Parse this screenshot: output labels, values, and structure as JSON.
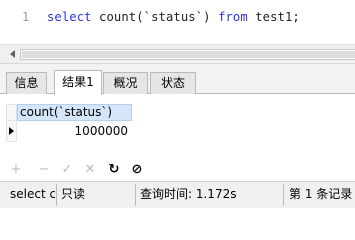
{
  "editor": {
    "line_number": "1",
    "code": {
      "kw_select": "select",
      "mid": " count(`status`) ",
      "kw_from": "from",
      "tail": " test1;"
    }
  },
  "tabs": [
    {
      "label": "信息"
    },
    {
      "label": "结果1",
      "active": true
    },
    {
      "label": "概况"
    },
    {
      "label": "状态"
    }
  ],
  "result": {
    "column": "count(`status`)",
    "rows": [
      [
        "1000000"
      ]
    ]
  },
  "grid_toolbar": {
    "add": "+",
    "delete": "−",
    "apply": "✓",
    "discard": "✕",
    "refresh": "↻",
    "stop": "⊘"
  },
  "status": {
    "sql": "select c",
    "mode": "只读",
    "query_time": "查询时间: 1.172s",
    "record": "第 1 条记录"
  },
  "colors": {
    "keyword": "#2f32d8",
    "column_header_bg": "#d5e6fb"
  }
}
